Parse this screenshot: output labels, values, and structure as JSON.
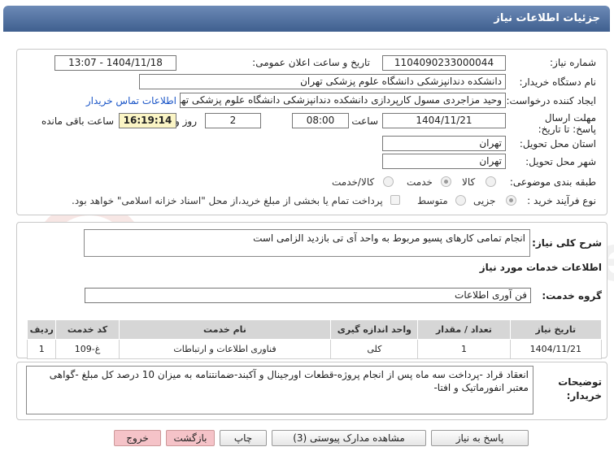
{
  "header": {
    "title": "جزئیات اطلاعات نیاز"
  },
  "form": {
    "need_number_label": "شماره نیاز:",
    "need_number": "1104090233000044",
    "announce_label": "تاریخ و ساعت اعلان عمومی:",
    "announce_value": "1404/11/18 - 13:07",
    "buyer_org_label": "نام دستگاه خریدار:",
    "buyer_org": "دانشکده دندانپزشکی دانشگاه علوم پزشکی تهران",
    "creator_label": "ایجاد کننده درخواست:",
    "creator": "وحید مزاجردی مسول کارپردازی دانشکده دندانپزشکی دانشگاه علوم پزشکی تهران",
    "contact_link": "اطلاعات تماس خریدار",
    "deadline_label": "مهلت ارسال پاسخ: تا تاریخ:",
    "deadline_date": "1404/11/21",
    "time_label": "ساعت",
    "deadline_time": "08:00",
    "days_value": "2",
    "days_label": "روز و",
    "remaining_time": "16:19:14",
    "remaining_label": "ساعت باقی مانده",
    "province_label": "استان محل تحویل:",
    "province": "تهران",
    "city_label": "شهر محل تحویل:",
    "city": "تهران",
    "category_label": "طبقه بندی موضوعی:",
    "category_options": [
      "کالا",
      "خدمت",
      "کالا/خدمت"
    ],
    "category_selected": "خدمت",
    "purchase_type_label": "نوع فرآیند خرید :",
    "purchase_options": [
      "جزیی",
      "متوسط"
    ],
    "purchase_selected": "جزیی",
    "payment_note": "پرداخت تمام یا بخشی از مبلغ خرید،از محل \"اسناد خزانه اسلامی\" خواهد بود."
  },
  "summary": {
    "label": "شرح کلی نیاز:",
    "text": "انجام تمامی کارهای پسیو مربوط به واحد آی تی بازدید الزامی است"
  },
  "services": {
    "section_title": "اطلاعات خدمات مورد نیاز",
    "group_label": "گروه خدمت:",
    "group_value": "فن آوری اطلاعات",
    "table": {
      "headers": [
        "ردیف",
        "کد خدمت",
        "نام خدمت",
        "واحد اندازه گیری",
        "تعداد / مقدار",
        "تاریخ نیاز"
      ],
      "rows": [
        [
          "1",
          "غ-109",
          "فناوری اطلاعات و ارتباطات",
          "کلی",
          "1",
          "1404/11/21"
        ]
      ]
    }
  },
  "buyer_notes": {
    "label": "توضیحات خریدار:",
    "text": "انعقاد قراد -پرداخت سه ماه پس از انجام پروژه-قطعات اورجینال و آکبند-ضمانتنامه به میزان 10 درصد کل مبلغ -گواهی معتبر انفورماتیک و افتا-"
  },
  "buttons": {
    "reply": "پاسخ به نیاز",
    "attachments": "مشاهده مدارک پیوستی (3)",
    "print": "چاپ",
    "back": "بازگشت",
    "exit": "خروج"
  },
  "watermark": {
    "text": "AriaTender.net"
  },
  "colors": {
    "header": "#4f6f9f",
    "link": "#1a55c7",
    "highlight": "#fbf5c5",
    "danger_button": "#f5c3c8"
  }
}
